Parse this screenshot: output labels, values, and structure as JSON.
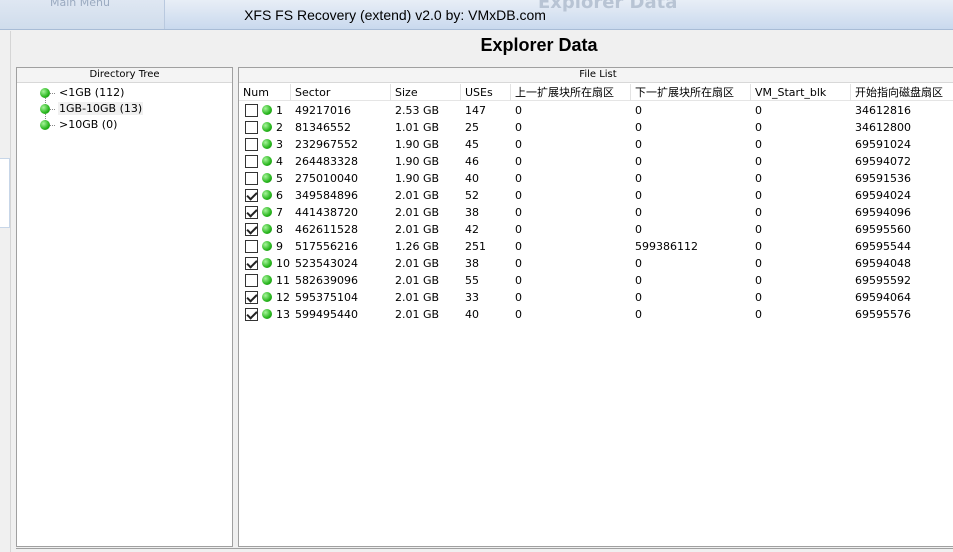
{
  "window": {
    "title": "XFS FS Recovery (extend) v2.0 by: VMxDB.com",
    "ghost_menu": "Main Menu",
    "ghost_title": "Explorer Data"
  },
  "page": {
    "title": "Explorer Data"
  },
  "tree": {
    "header": "Directory Tree",
    "items": [
      {
        "label": "<1GB  (112)"
      },
      {
        "label": "1GB-10GB  (13)"
      },
      {
        "label": ">10GB  (0)"
      }
    ]
  },
  "file_list": {
    "header": "File List",
    "columns": [
      "Num",
      "Sector",
      "Size",
      "USEs",
      "上一扩展块所在扇区",
      "下一扩展块所在扇区",
      "VM_Start_blk",
      "开始指向磁盘扇区"
    ],
    "rows": [
      {
        "num": "1",
        "checked": false,
        "sector": "49217016",
        "size": "2.53 GB",
        "uses": "147",
        "prev": "0",
        "next": "0",
        "vm": "0",
        "start": "34612816"
      },
      {
        "num": "2",
        "checked": false,
        "sector": "81346552",
        "size": "1.01 GB",
        "uses": "25",
        "prev": "0",
        "next": "0",
        "vm": "0",
        "start": "34612800"
      },
      {
        "num": "3",
        "checked": false,
        "sector": "232967552",
        "size": "1.90 GB",
        "uses": "45",
        "prev": "0",
        "next": "0",
        "vm": "0",
        "start": "69591024"
      },
      {
        "num": "4",
        "checked": false,
        "sector": "264483328",
        "size": "1.90 GB",
        "uses": "46",
        "prev": "0",
        "next": "0",
        "vm": "0",
        "start": "69594072"
      },
      {
        "num": "5",
        "checked": false,
        "sector": "275010040",
        "size": "1.90 GB",
        "uses": "40",
        "prev": "0",
        "next": "0",
        "vm": "0",
        "start": "69591536"
      },
      {
        "num": "6",
        "checked": true,
        "sector": "349584896",
        "size": "2.01 GB",
        "uses": "52",
        "prev": "0",
        "next": "0",
        "vm": "0",
        "start": "69594024"
      },
      {
        "num": "7",
        "checked": true,
        "sector": "441438720",
        "size": "2.01 GB",
        "uses": "38",
        "prev": "0",
        "next": "0",
        "vm": "0",
        "start": "69594096"
      },
      {
        "num": "8",
        "checked": true,
        "sector": "462611528",
        "size": "2.01 GB",
        "uses": "42",
        "prev": "0",
        "next": "0",
        "vm": "0",
        "start": "69595560"
      },
      {
        "num": "9",
        "checked": false,
        "sector": "517556216",
        "size": "1.26 GB",
        "uses": "251",
        "prev": "0",
        "next": "599386112",
        "vm": "0",
        "start": "69595544"
      },
      {
        "num": "10",
        "checked": true,
        "sector": "523543024",
        "size": "2.01 GB",
        "uses": "38",
        "prev": "0",
        "next": "0",
        "vm": "0",
        "start": "69594048"
      },
      {
        "num": "11",
        "checked": false,
        "sector": "582639096",
        "size": "2.01 GB",
        "uses": "55",
        "prev": "0",
        "next": "0",
        "vm": "0",
        "start": "69595592"
      },
      {
        "num": "12",
        "checked": true,
        "sector": "595375104",
        "size": "2.01 GB",
        "uses": "33",
        "prev": "0",
        "next": "0",
        "vm": "0",
        "start": "69594064"
      },
      {
        "num": "13",
        "checked": true,
        "sector": "599495440",
        "size": "2.01 GB",
        "uses": "40",
        "prev": "0",
        "next": "0",
        "vm": "0",
        "start": "69595576"
      }
    ]
  },
  "colors": {
    "status_dot": "#27b51c",
    "title_bar": "#c9d9ee"
  }
}
